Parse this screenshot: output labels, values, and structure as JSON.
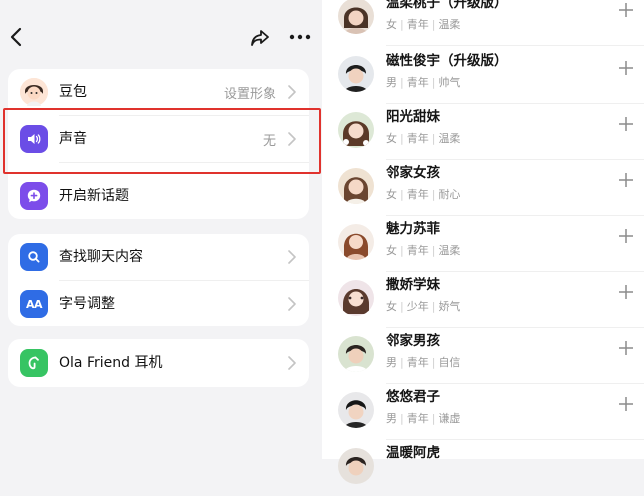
{
  "header": {
    "back_icon": "chevron-left-icon",
    "share_icon": "share-icon",
    "more_icon": "more-dots-icon"
  },
  "settings": {
    "group1": [
      {
        "label": "豆包",
        "value": "设置形象",
        "icon": "avatar"
      },
      {
        "label": "声音",
        "value": "无",
        "icon": "speaker-icon"
      },
      {
        "label": "开启新话题",
        "value": "",
        "icon": "new-chat-icon"
      }
    ],
    "group2": [
      {
        "label": "查找聊天内容",
        "value": "",
        "icon": "search-icon"
      },
      {
        "label": "字号调整",
        "value": "",
        "icon": "font-size-icon",
        "icon_text": "AA"
      }
    ],
    "group3": [
      {
        "label": "Ola Friend 耳机",
        "value": "",
        "icon": "earbuds-icon"
      }
    ]
  },
  "voices": [
    {
      "name": "温柔桃子（升级版）",
      "gender": "女",
      "age": "青年",
      "style": "温柔"
    },
    {
      "name": "磁性俊宇（升级版）",
      "gender": "男",
      "age": "青年",
      "style": "帅气"
    },
    {
      "name": "阳光甜妹",
      "gender": "女",
      "age": "青年",
      "style": "温柔"
    },
    {
      "name": "邻家女孩",
      "gender": "女",
      "age": "青年",
      "style": "耐心"
    },
    {
      "name": "魅力苏菲",
      "gender": "女",
      "age": "青年",
      "style": "温柔"
    },
    {
      "name": "撒娇学妹",
      "gender": "女",
      "age": "少年",
      "style": "娇气"
    },
    {
      "name": "邻家男孩",
      "gender": "男",
      "age": "青年",
      "style": "自信"
    },
    {
      "name": "悠悠君子",
      "gender": "男",
      "age": "青年",
      "style": "谦虚"
    },
    {
      "name": "温暖阿虎",
      "gender": "",
      "age": "",
      "style": ""
    }
  ],
  "colors": {
    "highlight": "#e0322d",
    "purple": "#6b4de6",
    "blue": "#2f6ce5",
    "green": "#37c463"
  }
}
